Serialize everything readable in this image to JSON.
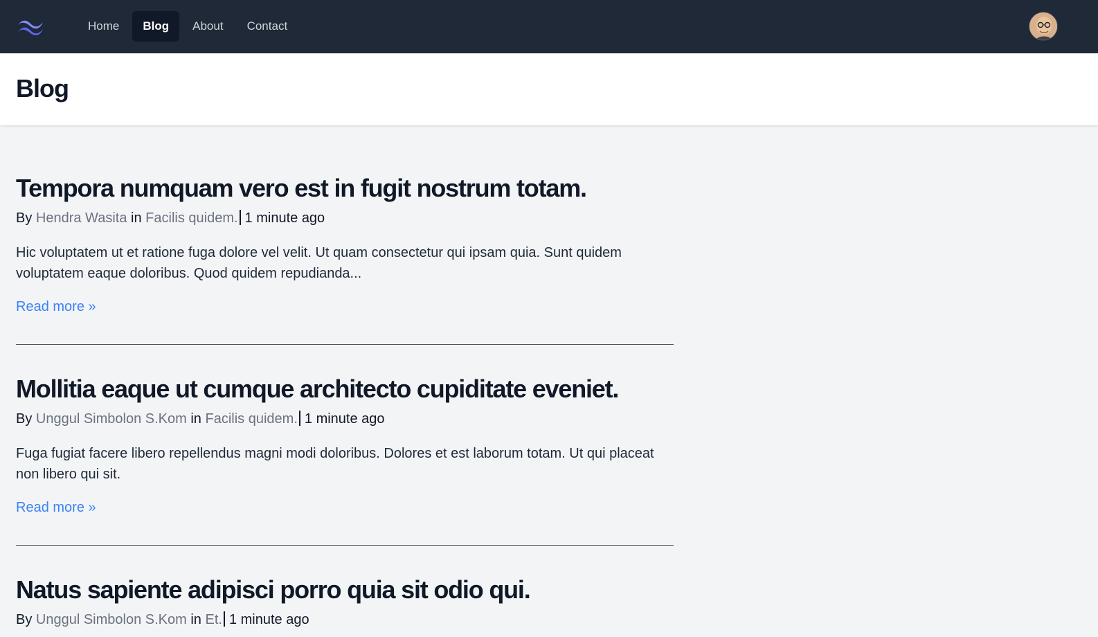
{
  "nav": {
    "logo_icon": "tailwind-wave-icon",
    "items": [
      {
        "label": "Home",
        "active": false
      },
      {
        "label": "Blog",
        "active": true
      },
      {
        "label": "About",
        "active": false
      },
      {
        "label": "Contact",
        "active": false
      }
    ],
    "avatar_icon": "user-avatar"
  },
  "page": {
    "title": "Blog"
  },
  "posts": [
    {
      "title": "Tempora numquam vero est in fugit nostrum totam.",
      "by_label": "By",
      "author": "Hendra Wasita",
      "in_label": "in",
      "category": "Facilis quidem.",
      "time": "1 minute ago",
      "excerpt": "Hic voluptatem ut et ratione fuga dolore vel velit. Ut quam consectetur qui ipsam quia. Sunt quidem voluptatem eaque doloribus. Quod quidem repudianda...",
      "read_more": "Read more »"
    },
    {
      "title": "Mollitia eaque ut cumque architecto cupiditate eveniet.",
      "by_label": "By",
      "author": "Unggul Simbolon S.Kom",
      "in_label": "in",
      "category": "Facilis quidem.",
      "time": "1 minute ago",
      "excerpt": "Fuga fugiat facere libero repellendus magni modi doloribus. Dolores et est laborum totam. Ut qui placeat non libero qui sit.",
      "read_more": "Read more »"
    },
    {
      "title": "Natus sapiente adipisci porro quia sit odio qui.",
      "by_label": "By",
      "author": "Unggul Simbolon S.Kom",
      "in_label": "in",
      "category": "Et.",
      "time": "1 minute ago"
    }
  ],
  "colors": {
    "nav_bg": "#1f2937",
    "page_bg": "#f3f4f6",
    "link_blue": "#3b82f6",
    "meta_gray": "#6b7280",
    "logo_color": "#818cf8"
  }
}
